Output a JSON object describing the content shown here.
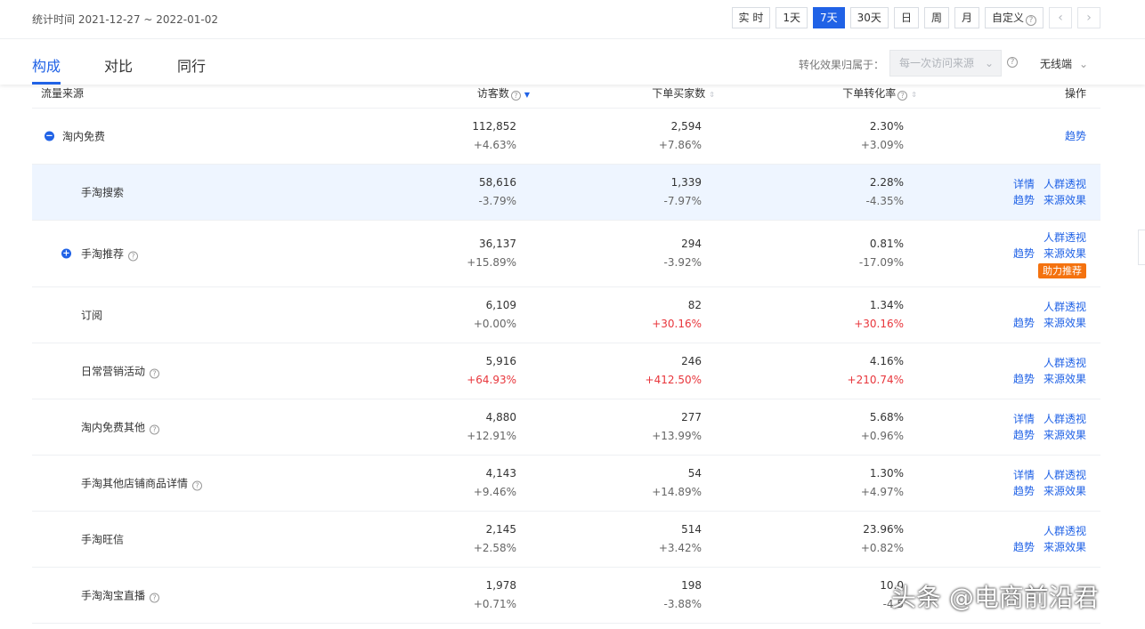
{
  "header": {
    "stat_time": "统计时间 2021-12-27 ~ 2022-01-02",
    "ranges": [
      "实 时",
      "1天",
      "7天",
      "30天",
      "日",
      "周",
      "月"
    ],
    "active_range": 2,
    "custom_label": "自定义",
    "prev_icon": "chevron-left-icon",
    "next_icon": "chevron-right-icon"
  },
  "tabs": {
    "items": [
      "构成",
      "对比",
      "同行"
    ],
    "active": 0,
    "attribution_label": "转化效果归属于：",
    "attribution_value": "每一次访问来源",
    "device_value": "无线端"
  },
  "table": {
    "headers": {
      "source": "流量来源",
      "visitors": "访客数",
      "buyers": "下单买家数",
      "rate": "下单转化率",
      "ops": "操作"
    },
    "rows": [
      {
        "name": "淘内免费",
        "visitors": "112,852",
        "visitors_chg": "+4.63%",
        "buyers": "2,594",
        "buyers_chg": "+7.86%",
        "rate": "2.30%",
        "rate_chg": "+3.09%",
        "ops1": [
          "趋势"
        ],
        "ops2": []
      },
      {
        "name": "手淘搜索",
        "visitors": "58,616",
        "visitors_chg": "-3.79%",
        "buyers": "1,339",
        "buyers_chg": "-7.97%",
        "rate": "2.28%",
        "rate_chg": "-4.35%",
        "ops1": [
          "详情",
          "人群透视"
        ],
        "ops2": [
          "趋势",
          "来源效果"
        ]
      },
      {
        "name": "手淘推荐",
        "visitors": "36,137",
        "visitors_chg": "+15.89%",
        "buyers": "294",
        "buyers_chg": "-3.92%",
        "rate": "0.81%",
        "rate_chg": "-17.09%",
        "ops1": [
          "人群透视"
        ],
        "ops2": [
          "趋势",
          "来源效果"
        ],
        "badge": "助力推荐"
      },
      {
        "name": "订阅",
        "visitors": "6,109",
        "visitors_chg": "+0.00%",
        "buyers": "82",
        "buyers_chg": "+30.16%",
        "rate": "1.34%",
        "rate_chg": "+30.16%",
        "ops1": [
          "人群透视"
        ],
        "ops2": [
          "趋势",
          "来源效果"
        ]
      },
      {
        "name": "日常营销活动",
        "visitors": "5,916",
        "visitors_chg": "+64.93%",
        "buyers": "246",
        "buyers_chg": "+412.50%",
        "rate": "4.16%",
        "rate_chg": "+210.74%",
        "ops1": [
          "人群透视"
        ],
        "ops2": [
          "趋势",
          "来源效果"
        ]
      },
      {
        "name": "淘内免费其他",
        "visitors": "4,880",
        "visitors_chg": "+12.91%",
        "buyers": "277",
        "buyers_chg": "+13.99%",
        "rate": "5.68%",
        "rate_chg": "+0.96%",
        "ops1": [
          "详情",
          "人群透视"
        ],
        "ops2": [
          "趋势",
          "来源效果"
        ]
      },
      {
        "name": "手淘其他店铺商品详情",
        "visitors": "4,143",
        "visitors_chg": "+9.46%",
        "buyers": "54",
        "buyers_chg": "+14.89%",
        "rate": "1.30%",
        "rate_chg": "+4.97%",
        "ops1": [
          "详情",
          "人群透视"
        ],
        "ops2": [
          "趋势",
          "来源效果"
        ]
      },
      {
        "name": "手淘旺信",
        "visitors": "2,145",
        "visitors_chg": "+2.58%",
        "buyers": "514",
        "buyers_chg": "+3.42%",
        "rate": "23.96%",
        "rate_chg": "+0.82%",
        "ops1": [
          "人群透视"
        ],
        "ops2": [
          "趋势",
          "来源效果"
        ]
      },
      {
        "name": "手淘淘宝直播",
        "visitors": "1,978",
        "visitors_chg": "+0.71%",
        "buyers": "198",
        "buyers_chg": "-3.88%",
        "rate": "10.0",
        "rate_chg": "-4.5",
        "ops1": [],
        "ops2": []
      }
    ]
  },
  "watermark": "头条 @电商前沿君",
  "colors": {
    "accent": "#2062e6",
    "negative": "#e8363c",
    "badge": "#f4720f",
    "highlight_row": "#eef5ff"
  }
}
